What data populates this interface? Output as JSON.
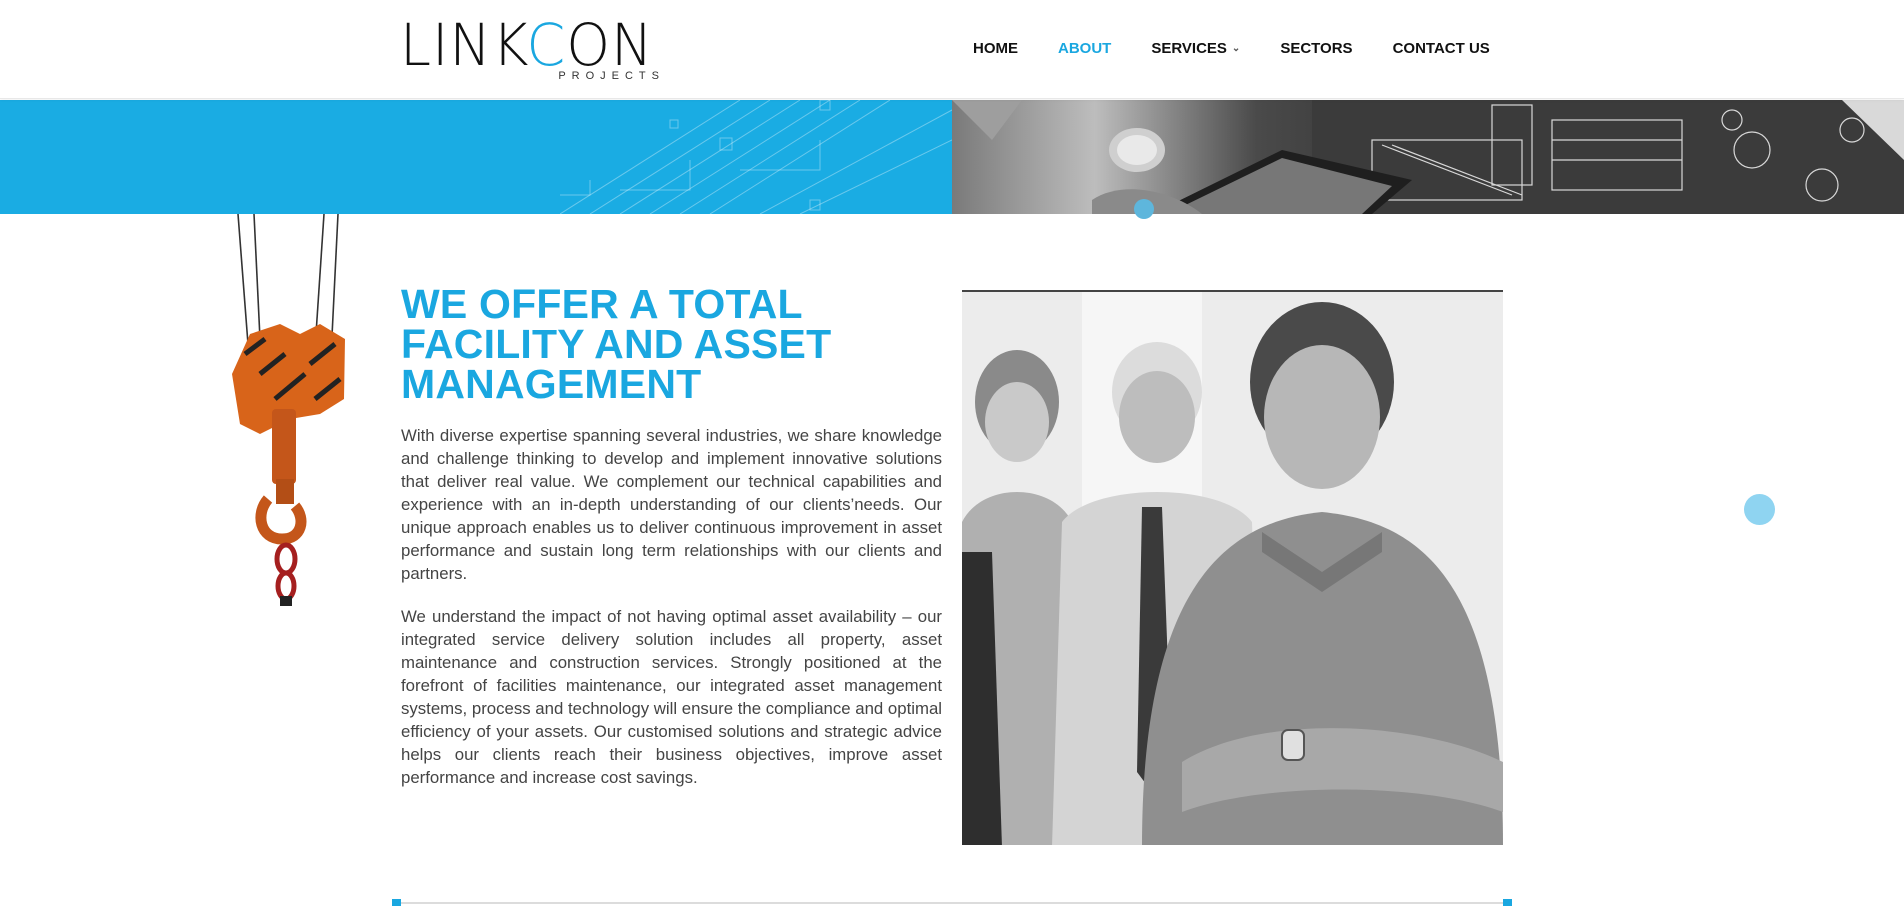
{
  "brand": {
    "logo_main": "LINKCON",
    "logo_sub": "PROJECTS",
    "accent_color": "#1aa7e0"
  },
  "nav": {
    "items": [
      {
        "label": "HOME",
        "active": false
      },
      {
        "label": "ABOUT",
        "active": true
      },
      {
        "label": "SERVICES",
        "active": false,
        "has_dropdown": true
      },
      {
        "label": "SECTORS",
        "active": false
      },
      {
        "label": "CONTACT US",
        "active": false
      }
    ],
    "dropdown_icon": "chevron-down-icon"
  },
  "main": {
    "headline_lines": [
      "WE OFFER A TOTAL",
      "FACILITY AND ASSET",
      "MANAGEMENT"
    ],
    "paragraph1": "With diverse expertise spanning several industries, we share knowledge and challenge thinking to develop and implement innovative solutions that deliver real value. We complement our technical capabilities and experience with an in-depth understanding of our clients’needs. Our unique approach enables us to deliver continuous improvement in asset performance and sustain long term relationships with our clients and partners.",
    "paragraph2": "We understand the impact of not having optimal asset availability –  our integrated service delivery solution includes all property, asset maintenance and construction services. Strongly positioned at the forefront of facilities maintenance, our integrated asset management systems, process and technology will ensure the compliance and optimal efficiency of your assets. Our customised solutions and strategic advice helps our clients reach their business objectives, improve asset performance and increase cost savings."
  }
}
